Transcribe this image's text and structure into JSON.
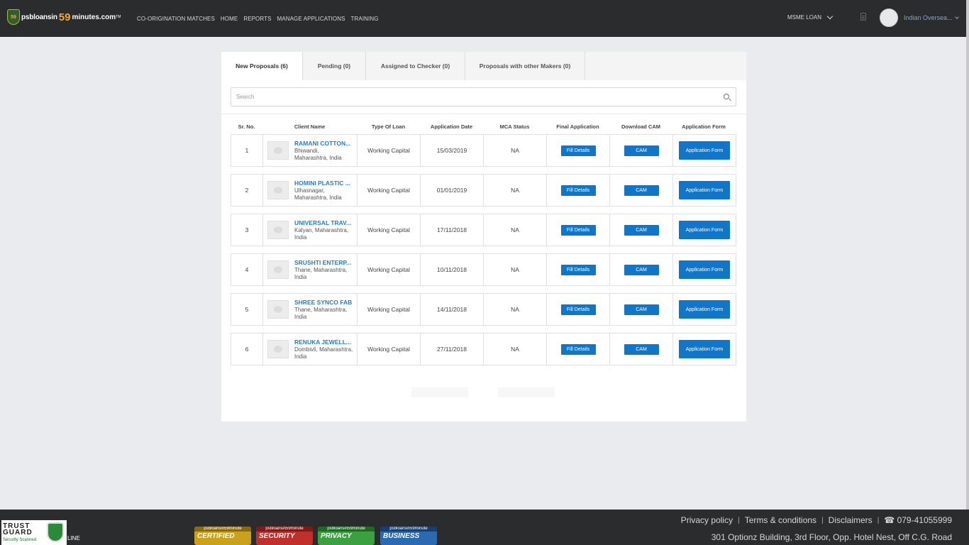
{
  "brand": {
    "badge": "59",
    "part1": "psbloansin",
    "part2": "59",
    "part3": "minutes.com",
    "tm": "TM"
  },
  "nav": [
    {
      "label": "CO-ORIGINATION MATCHES"
    },
    {
      "label": "HOME"
    },
    {
      "label": "REPORTS"
    },
    {
      "label": "MANAGE APPLICATIONS"
    },
    {
      "label": "TRAINING"
    }
  ],
  "loan_select": "MSME LOAN",
  "user": {
    "name": "Indian Oversea..."
  },
  "tabs": [
    {
      "label": "New Proposals (6)",
      "active": true
    },
    {
      "label": "Pending (0)",
      "active": false
    },
    {
      "label": "Assigned to Checker (0)",
      "active": false
    },
    {
      "label": "Proposals with other Makers (0)",
      "active": false
    }
  ],
  "search": {
    "placeholder": "Search"
  },
  "table": {
    "headers": [
      "Sr. No.",
      "Client Name",
      "Type Of Loan",
      "Application Date",
      "MCA Status",
      "Final Application",
      "Download CAM",
      "Application Form"
    ],
    "rows": [
      {
        "sr": "1",
        "name": "RAMANI COTTON...",
        "location": "Bhiwandi, Maharashtra, India",
        "type": "Working Capital",
        "date": "15/03/2019",
        "mca": "NA",
        "fill": "Fill Details",
        "cam": "CAM",
        "form": "Application Form"
      },
      {
        "sr": "2",
        "name": "HOMINI PLASTIC ...",
        "location": "Ulhasnagar, Maharashtra, India",
        "type": "Working Capital",
        "date": "01/01/2019",
        "mca": "NA",
        "fill": "Fill Details",
        "cam": "CAM",
        "form": "Application Form"
      },
      {
        "sr": "3",
        "name": "UNIVERSAL TRAV...",
        "location": "Kalyan, Maharashtra, India",
        "type": "Working Capital",
        "date": "17/11/2018",
        "mca": "NA",
        "fill": "Fill Details",
        "cam": "CAM",
        "form": "Application Form"
      },
      {
        "sr": "4",
        "name": "SRUSHTI ENTERP...",
        "location": "Thane, Maharashtra, India",
        "type": "Working Capital",
        "date": "10/11/2018",
        "mca": "NA",
        "fill": "Fill Details",
        "cam": "CAM",
        "form": "Application Form"
      },
      {
        "sr": "5",
        "name": "SHREE SYNCO FAB",
        "location": "Thane, Maharashtra, India",
        "type": "Working Capital",
        "date": "14/11/2018",
        "mca": "NA",
        "fill": "Fill Details",
        "cam": "CAM",
        "form": "Application Form"
      },
      {
        "sr": "6",
        "name": "RENUKA JEWELL...",
        "location": "Dombivli, Maharashtra, India",
        "type": "Working Capital",
        "date": "27/11/2018",
        "mca": "NA",
        "fill": "Fill Details",
        "cam": "CAM",
        "form": "Application Form"
      }
    ]
  },
  "footer": {
    "trust_line1": "TRUST",
    "trust_line2": "GUARD",
    "trust_sub": "Security Scanned",
    "online": "LINE",
    "seals": [
      {
        "top": "psbloansin59minute",
        "main": "CERTIFIED",
        "color": "#c9a21a"
      },
      {
        "top": "psbloansin59minute",
        "main": "SECURITY",
        "color": "#c0302a"
      },
      {
        "top": "psbloansin59minute",
        "main": "PRIVACY",
        "color": "#3aa040"
      },
      {
        "top": "psbloansin59minute",
        "main": "BUSINESS",
        "color": "#2a6ab0"
      }
    ],
    "links": [
      "Privacy policy",
      "Terms & conditions",
      "Disclaimers"
    ],
    "phone": "☎ 079-41055999",
    "address": "301 Optionz Building, 3rd Floor, Opp. Hotel Nest, Off C.G. Road"
  }
}
